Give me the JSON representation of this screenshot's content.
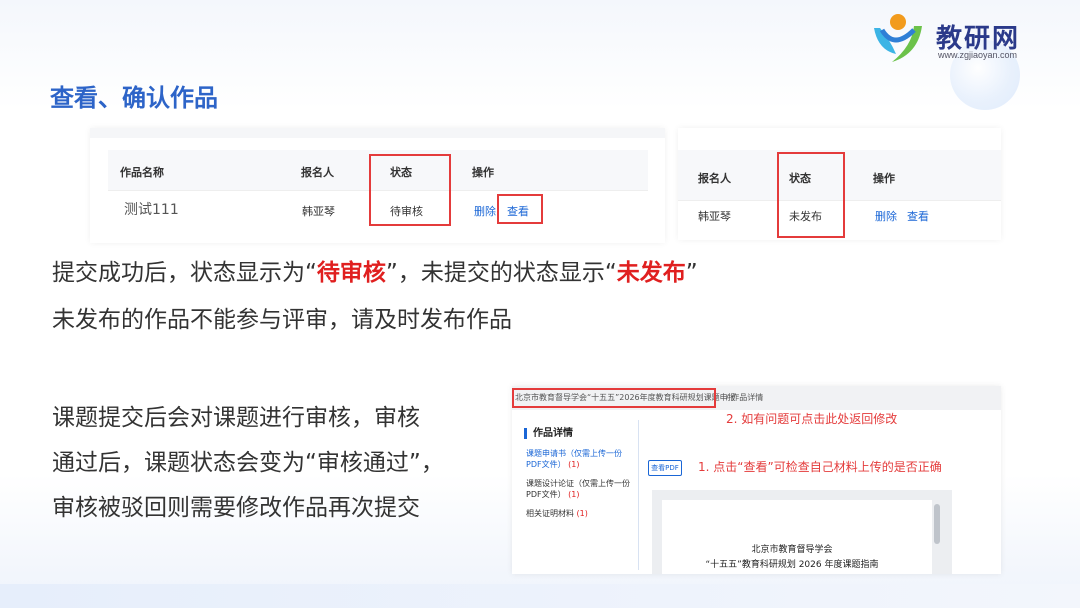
{
  "logo": {
    "name": "教研网",
    "url": "www.zgjiaoyan.com"
  },
  "page_title": "查看、确认作品",
  "table1": {
    "headers": [
      "作品名称",
      "报名人",
      "状态",
      "操作"
    ],
    "row": {
      "name": "测试111",
      "applicant": "韩亚琴",
      "status": "待审核",
      "delete": "删除",
      "view": "查看"
    }
  },
  "table2": {
    "headers": [
      "报名人",
      "状态",
      "操作"
    ],
    "row": {
      "applicant": "韩亚琴",
      "status": "未发布",
      "delete": "删除",
      "view": "查看"
    }
  },
  "text1": {
    "line1_a": "提交成功后，状态显示为“",
    "line1_b": "待审核",
    "line1_c": "”，未提交的状态显示“",
    "line1_d": "未发布",
    "line1_e": "”",
    "line2": "未发布的作品不能参与评审，请及时发布作品"
  },
  "text2": {
    "line1": "课题提交后会对课题进行审核，审核",
    "line2": "通过后，课题状态会变为“审核通过”，",
    "line3": "审核被驳回则需要修改作品再次提交"
  },
  "detail": {
    "breadcrumb": "北京市教育督导学会“十五五”2026年度教育科研规划课题申报",
    "breadcrumb_current": "作品详情",
    "heading": "作品详情",
    "side_items": [
      {
        "label": "课题申请书（仅需上传一份PDF文件）",
        "count": "(1)"
      },
      {
        "label": "课题设计论证（仅需上传一份PDF文件）",
        "count": "(1)"
      },
      {
        "label": "相关证明材料",
        "count": "(1)"
      }
    ],
    "view_button": "查看PDF",
    "doc_title_1": "北京市教育督导学会",
    "doc_title_2": "“十五五”教育科研规划 2026 年度课题指南",
    "note1": "1. 点击“查看”可检查自己材料上传的是否正确",
    "note2": "2. 如有问题可点击此处返回修改"
  },
  "colors": {
    "accent": "#2d64c8",
    "highlight_red": "#e43b3b",
    "link": "#1a66d6"
  }
}
